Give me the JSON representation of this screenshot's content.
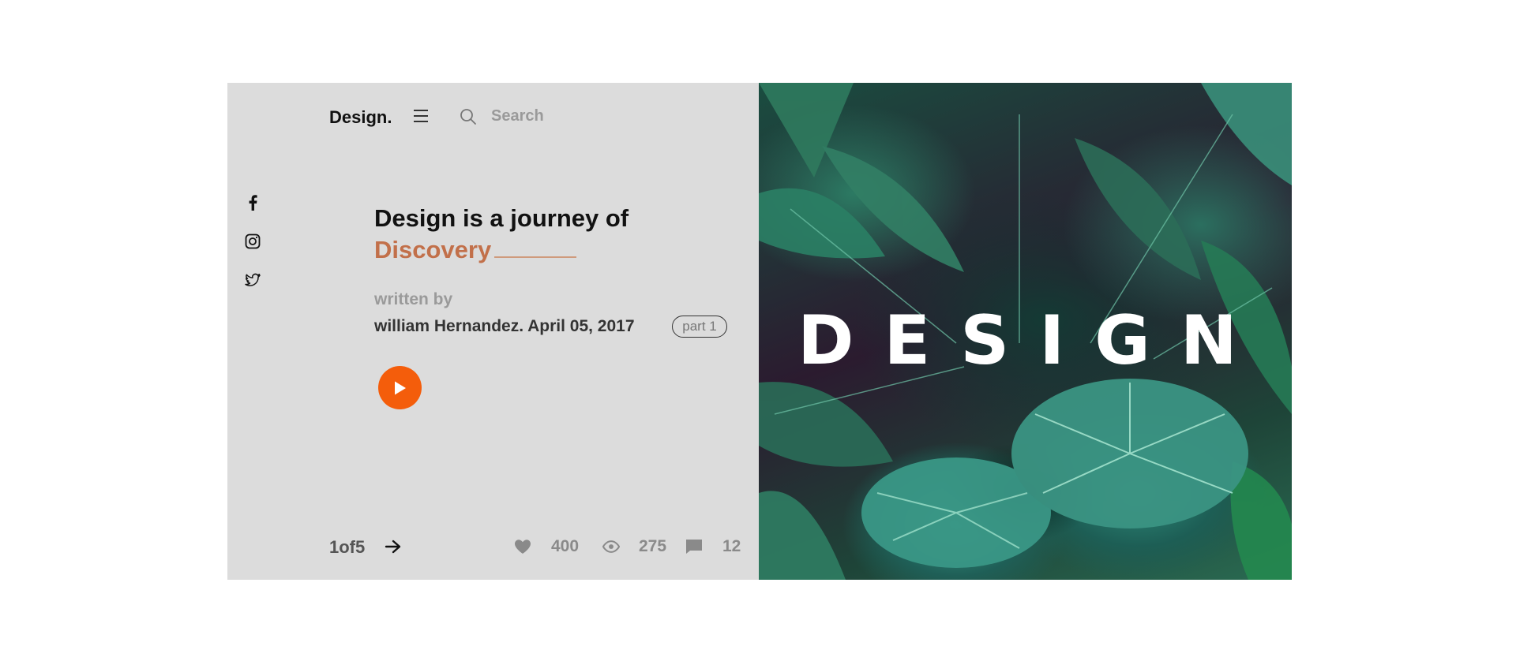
{
  "header": {
    "logo": "Design.",
    "menu_icon": "hamburger-menu-icon",
    "search_icon": "search-icon",
    "search_placeholder": "Search"
  },
  "social": [
    {
      "name": "facebook-icon"
    },
    {
      "name": "instagram-icon"
    },
    {
      "name": "twitter-icon"
    }
  ],
  "article": {
    "headline": "Design is a journey of",
    "highlight": "Discovery",
    "written_by": "written by",
    "byline": "william Hernandez. April 05, 2017",
    "part": "part 1",
    "play_icon": "play-icon"
  },
  "footer": {
    "pager": "1of5",
    "next_icon": "arrow-right-icon",
    "likes": "400",
    "views": "275",
    "comments": "12"
  },
  "hero": {
    "word": "DESIGN"
  },
  "colors": {
    "accent": "#f45d0b",
    "highlight": "#c2704a",
    "panel": "#dcdcdc"
  }
}
